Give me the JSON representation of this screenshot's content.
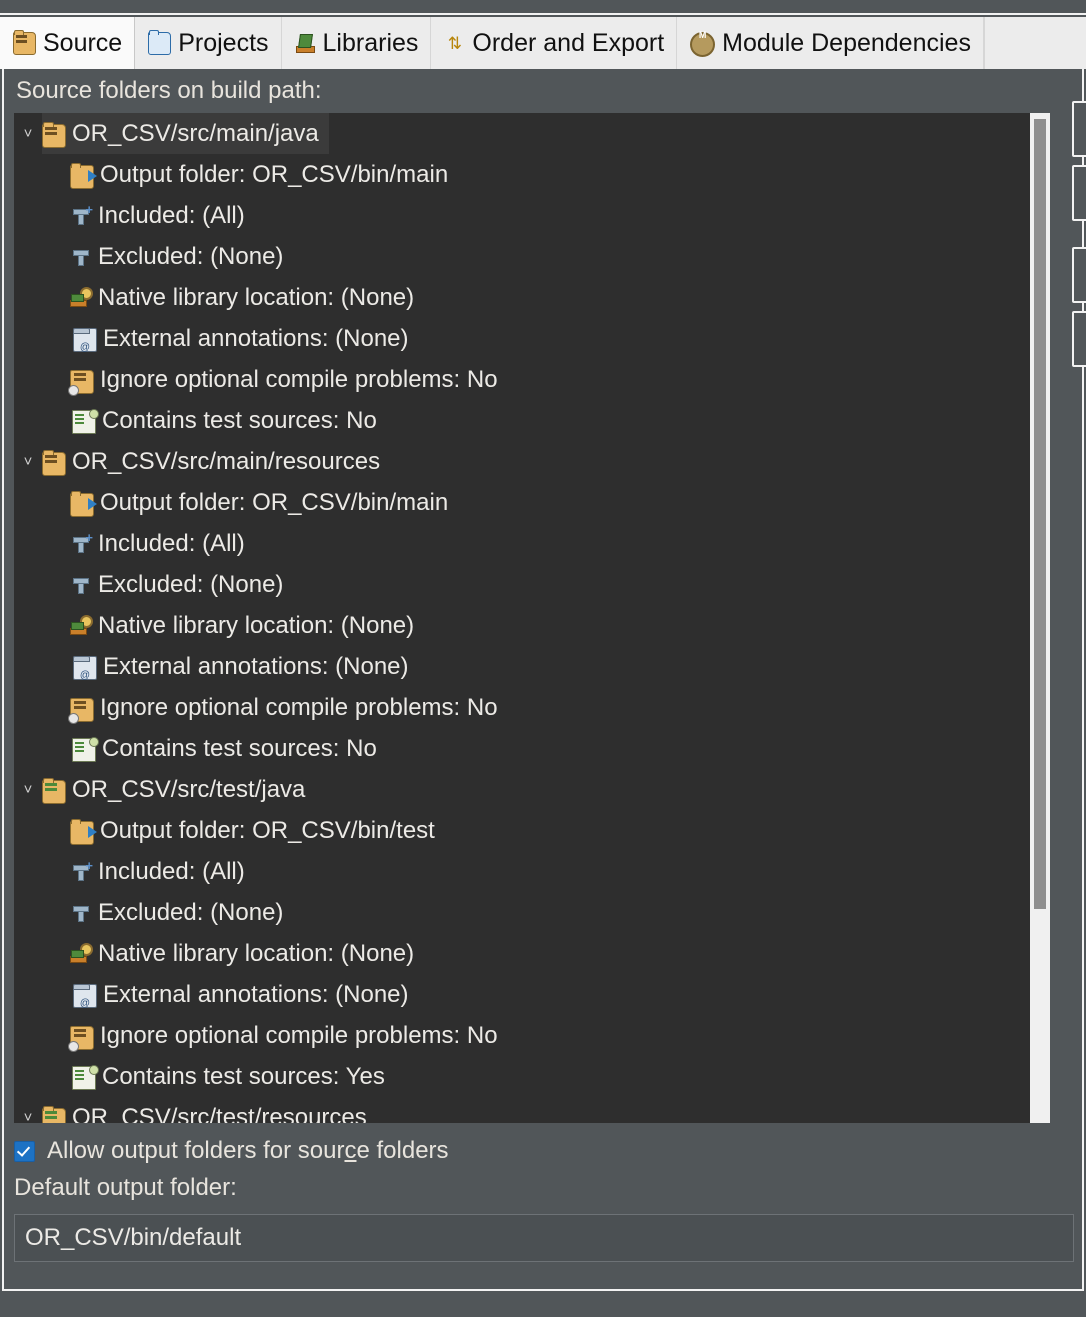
{
  "tabs": [
    {
      "label": "Source",
      "icon": "source-folder-icon",
      "active": true
    },
    {
      "label": "Projects",
      "icon": "open-folder-icon",
      "active": false
    },
    {
      "label": "Libraries",
      "icon": "books-icon",
      "active": false
    },
    {
      "label": "Order and Export",
      "icon": "arrows-icon",
      "active": false
    },
    {
      "label": "Module Dependencies",
      "icon": "module-circle-icon",
      "active": false
    }
  ],
  "panel": {
    "label": "Source folders on build path:"
  },
  "tree": {
    "rows": [
      {
        "label": "OR_CSV/src/main/java",
        "icon": "package-folder-icon",
        "level": 0,
        "twisty": "˅",
        "selected": true
      },
      {
        "label": "Output folder: OR_CSV/bin/main",
        "icon": "output-folder-icon",
        "level": 1,
        "twisty": "",
        "selected": false
      },
      {
        "label": "Included: (All)",
        "icon": "filter-include-icon",
        "level": 1,
        "twisty": "",
        "selected": false
      },
      {
        "label": "Excluded: (None)",
        "icon": "filter-exclude-icon",
        "level": 1,
        "twisty": "",
        "selected": false
      },
      {
        "label": "Native library location: (None)",
        "icon": "native-library-icon",
        "level": 1,
        "twisty": "",
        "selected": false
      },
      {
        "label": "External annotations: (None)",
        "icon": "annotation-jar-icon",
        "level": 1,
        "twisty": "",
        "selected": false
      },
      {
        "label": "Ignore optional compile problems: No",
        "icon": "ignore-problems-icon",
        "level": 1,
        "twisty": "",
        "selected": false
      },
      {
        "label": "Contains test sources: No",
        "icon": "test-sources-icon",
        "level": 1,
        "twisty": "",
        "selected": false
      },
      {
        "label": "OR_CSV/src/main/resources",
        "icon": "package-folder-icon",
        "level": 0,
        "twisty": "˅",
        "selected": false
      },
      {
        "label": "Output folder: OR_CSV/bin/main",
        "icon": "output-folder-icon",
        "level": 1,
        "twisty": "",
        "selected": false
      },
      {
        "label": "Included: (All)",
        "icon": "filter-include-icon",
        "level": 1,
        "twisty": "",
        "selected": false
      },
      {
        "label": "Excluded: (None)",
        "icon": "filter-exclude-icon",
        "level": 1,
        "twisty": "",
        "selected": false
      },
      {
        "label": "Native library location: (None)",
        "icon": "native-library-icon",
        "level": 1,
        "twisty": "",
        "selected": false
      },
      {
        "label": "External annotations: (None)",
        "icon": "annotation-jar-icon",
        "level": 1,
        "twisty": "",
        "selected": false
      },
      {
        "label": "Ignore optional compile problems: No",
        "icon": "ignore-problems-icon",
        "level": 1,
        "twisty": "",
        "selected": false
      },
      {
        "label": "Contains test sources: No",
        "icon": "test-sources-icon",
        "level": 1,
        "twisty": "",
        "selected": false
      },
      {
        "label": "OR_CSV/src/test/java",
        "icon": "package-folder-test-icon",
        "level": 0,
        "twisty": "˅",
        "selected": false
      },
      {
        "label": "Output folder: OR_CSV/bin/test",
        "icon": "output-folder-icon",
        "level": 1,
        "twisty": "",
        "selected": false
      },
      {
        "label": "Included: (All)",
        "icon": "filter-include-icon",
        "level": 1,
        "twisty": "",
        "selected": false
      },
      {
        "label": "Excluded: (None)",
        "icon": "filter-exclude-icon",
        "level": 1,
        "twisty": "",
        "selected": false
      },
      {
        "label": "Native library location: (None)",
        "icon": "native-library-icon",
        "level": 1,
        "twisty": "",
        "selected": false
      },
      {
        "label": "External annotations: (None)",
        "icon": "annotation-jar-icon",
        "level": 1,
        "twisty": "",
        "selected": false
      },
      {
        "label": "Ignore optional compile problems: No",
        "icon": "ignore-problems-icon",
        "level": 1,
        "twisty": "",
        "selected": false
      },
      {
        "label": "Contains test sources: Yes",
        "icon": "test-sources-icon",
        "level": 1,
        "twisty": "",
        "selected": false
      },
      {
        "label": "OR_CSV/src/test/resources",
        "icon": "package-folder-test-icon",
        "level": 0,
        "twisty": "˅",
        "selected": false
      }
    ]
  },
  "allow_output": {
    "label_before": "Allow output folders for sour",
    "label_mnemonic": "c",
    "label_after": "e folders",
    "checked": true
  },
  "default_output": {
    "label": "Default output folder:",
    "value": "OR_CSV/bin/default"
  },
  "colors": {
    "window_bg": "#515659",
    "tab_active_bg": "#fafafa",
    "tab_inactive_bg": "#ececec",
    "tree_bg": "#2e2e2e",
    "tree_selected_bg": "#3b3b3b",
    "text": "#eceae6",
    "checkbox_accent": "#1d72c4",
    "scrollbar_track": "#f0f0f0",
    "scrollbar_thumb": "#8e8e8e"
  }
}
